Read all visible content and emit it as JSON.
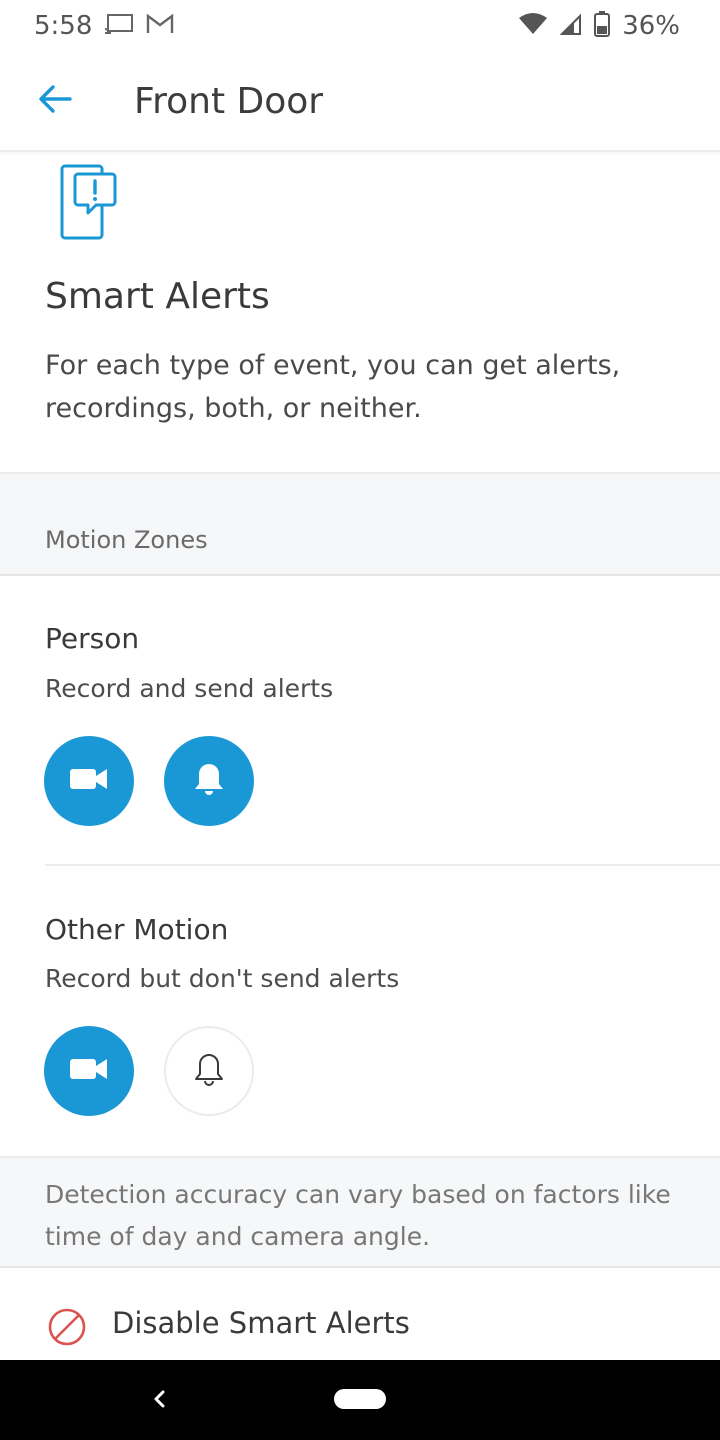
{
  "status_bar": {
    "time": "5:58",
    "battery_percent": "36%",
    "icons": [
      "cast-icon",
      "gmail-icon",
      "wifi-icon",
      "signal-icon",
      "battery-icon"
    ]
  },
  "app_bar": {
    "title": "Front Door",
    "back_icon": "arrow-left-icon"
  },
  "hero": {
    "icon": "phone-alert-icon",
    "title": "Smart Alerts",
    "description": "For each type of event, you can get alerts, recordings, both, or neither."
  },
  "section": {
    "title": "Motion Zones"
  },
  "events": [
    {
      "name": "Person",
      "status": "Record and send alerts",
      "record_enabled": true,
      "alerts_enabled": true
    },
    {
      "name": "Other Motion",
      "status": "Record but don't send alerts",
      "record_enabled": true,
      "alerts_enabled": false
    }
  ],
  "footnote": "Detection accuracy can vary based on factors like time of day and camera angle.",
  "disable": {
    "label": "Disable Smart Alerts",
    "icon": "prohibited-icon"
  },
  "colors": {
    "accent": "#1a98d5",
    "danger": "#d9534f"
  }
}
